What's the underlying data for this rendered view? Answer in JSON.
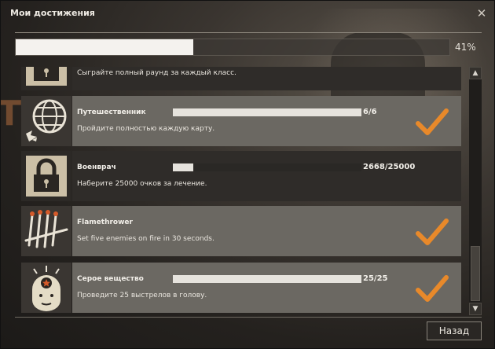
{
  "window": {
    "title": "Мои достижения",
    "close_icon": "close-icon"
  },
  "overall": {
    "progress_percent": 41,
    "label": "41%"
  },
  "achievements": [
    {
      "name": "",
      "description": "Сыграйте полный раунд за каждый класс.",
      "state": "locked",
      "icon": "lock-icon"
    },
    {
      "name": "Путешественник",
      "description": "Пройдите полностью каждую карту.",
      "progress": "6/6",
      "progress_fraction": 1.0,
      "state": "done",
      "icon": "globe-icon"
    },
    {
      "name": "Военврач",
      "description": "Наберите 25000 очков за лечение.",
      "progress": "2668/25000",
      "progress_fraction": 0.107,
      "state": "locked",
      "icon": "lock-icon"
    },
    {
      "name": "Flamethrower",
      "description": "Set five enemies on fire in 30 seconds.",
      "state": "done",
      "icon": "matches-icon"
    },
    {
      "name": "Серое вещество",
      "description": "Проведите 25 выстрелов в голову.",
      "progress": "25/25",
      "progress_fraction": 1.0,
      "state": "done",
      "icon": "head-star-icon"
    }
  ],
  "buttons": {
    "back_label": "Назад"
  },
  "colors": {
    "check": "#e8892a",
    "card_done": "#6b6862",
    "card_todo": "#2f2c29"
  }
}
